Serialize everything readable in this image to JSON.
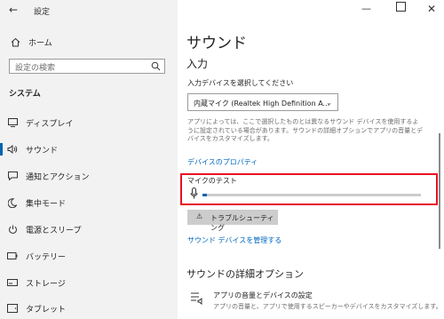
{
  "window": {
    "title": "設定"
  },
  "sidebar": {
    "home_label": "ホーム",
    "search_placeholder": "設定の検索",
    "section_title": "システム",
    "items": [
      {
        "label": "ディスプレイ",
        "icon": "display-icon"
      },
      {
        "label": "サウンド",
        "icon": "speaker-icon",
        "active": true
      },
      {
        "label": "通知とアクション",
        "icon": "notification-icon"
      },
      {
        "label": "集中モード",
        "icon": "moon-icon"
      },
      {
        "label": "電源とスリープ",
        "icon": "power-icon"
      },
      {
        "label": "バッテリー",
        "icon": "battery-icon"
      },
      {
        "label": "ストレージ",
        "icon": "storage-icon"
      },
      {
        "label": "タブレット",
        "icon": "tablet-icon"
      }
    ]
  },
  "main": {
    "title": "サウンド",
    "input_heading": "入力",
    "input_device_label": "入力デバイスを選択してください",
    "input_device_value": "内蔵マイク (Realtek High Definition A...",
    "description": "アプリによっては、ここで選択したものとは異なるサウンド デバイスを使用するように設定されている場合があります。サウンドの詳細オプションでアプリの音量とデバイスをカスタマイズします。",
    "device_properties_link": "デバイスのプロパティ",
    "mic_test_label": "マイクのテスト",
    "mic_level": 0.02,
    "troubleshoot_label": "トラブルシューティング",
    "manage_devices_link": "サウンド デバイスを管理する",
    "advanced_heading": "サウンドの詳細オプション",
    "app_volume_title": "アプリの音量とデバイスの設定",
    "app_volume_desc": "アプリの音量と、アプリで使用するスピーカーやデバイスをカスタマイズします。"
  },
  "colors": {
    "accent": "#0063b1",
    "highlight": "#e81123",
    "link": "#0067c0"
  }
}
